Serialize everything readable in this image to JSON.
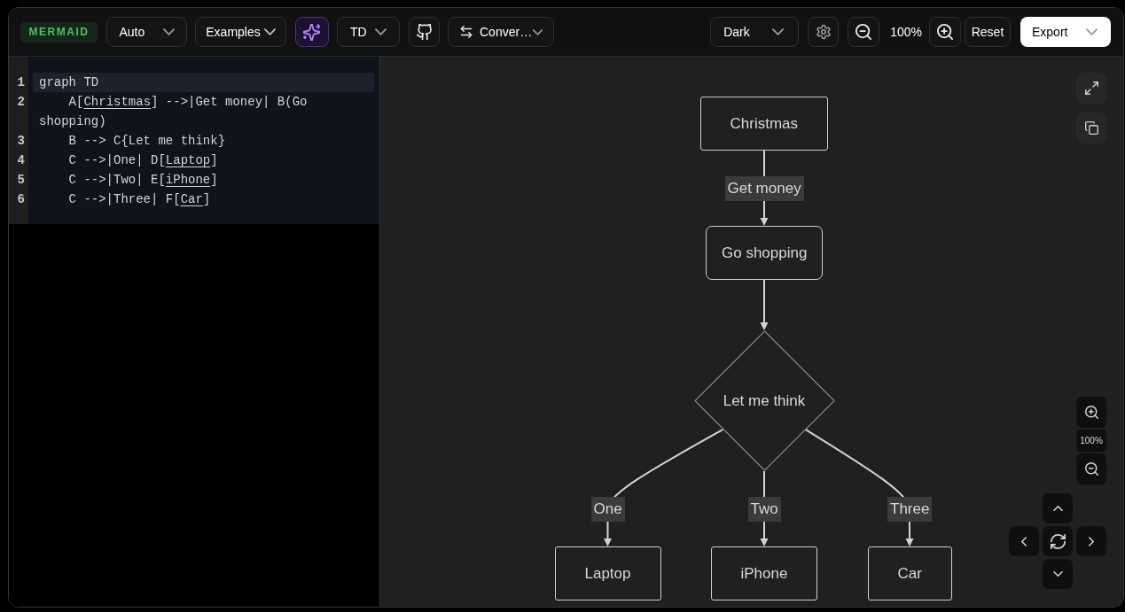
{
  "toolbar": {
    "logo": "MERMAID",
    "renderer": "Auto",
    "examples": "Examples",
    "direction": "TD",
    "convert": "Conver…",
    "theme": "Dark",
    "zoom": "100%",
    "reset": "Reset",
    "export": "Export"
  },
  "editor": {
    "lines": [
      {
        "number": "1",
        "current": true,
        "segments": [
          {
            "text": "graph TD",
            "underline": false
          }
        ]
      },
      {
        "number": "2",
        "current": false,
        "segments": [
          {
            "text": "    A[",
            "underline": false
          },
          {
            "text": "Christmas",
            "underline": true
          },
          {
            "text": "] -->|Get money| B(Go shopping)",
            "underline": false
          }
        ]
      },
      {
        "number": "3",
        "current": false,
        "segments": [
          {
            "text": "    B --> C{Let me think}",
            "underline": false
          }
        ]
      },
      {
        "number": "4",
        "current": false,
        "segments": [
          {
            "text": "    C -->|One| D[",
            "underline": false
          },
          {
            "text": "Laptop",
            "underline": true
          },
          {
            "text": "]",
            "underline": false
          }
        ]
      },
      {
        "number": "5",
        "current": false,
        "segments": [
          {
            "text": "    C -->|Two| E[",
            "underline": false
          },
          {
            "text": "iPhone",
            "underline": true
          },
          {
            "text": "]",
            "underline": false
          }
        ]
      },
      {
        "number": "6",
        "current": false,
        "segments": [
          {
            "text": "    C -->|Three| F[",
            "underline": false
          },
          {
            "text": "Car",
            "underline": true
          },
          {
            "text": "]",
            "underline": false
          }
        ]
      }
    ]
  },
  "diagram": {
    "root": {
      "label": "Christmas",
      "kind": "rect",
      "children": [
        {
          "edge_label": "Get money",
          "label": "Go shopping",
          "kind": "round",
          "children": [
            {
              "label": "Let me think",
              "kind": "diamond",
              "children": [
                {
                  "edge_label": "One",
                  "label": "Laptop",
                  "kind": "rect"
                },
                {
                  "edge_label": "Two",
                  "label": "iPhone",
                  "kind": "rect"
                },
                {
                  "edge_label": "Three",
                  "label": "Car",
                  "kind": "rect"
                }
              ]
            }
          ]
        }
      ]
    }
  },
  "preview_controls": {
    "zoom": "100%"
  }
}
